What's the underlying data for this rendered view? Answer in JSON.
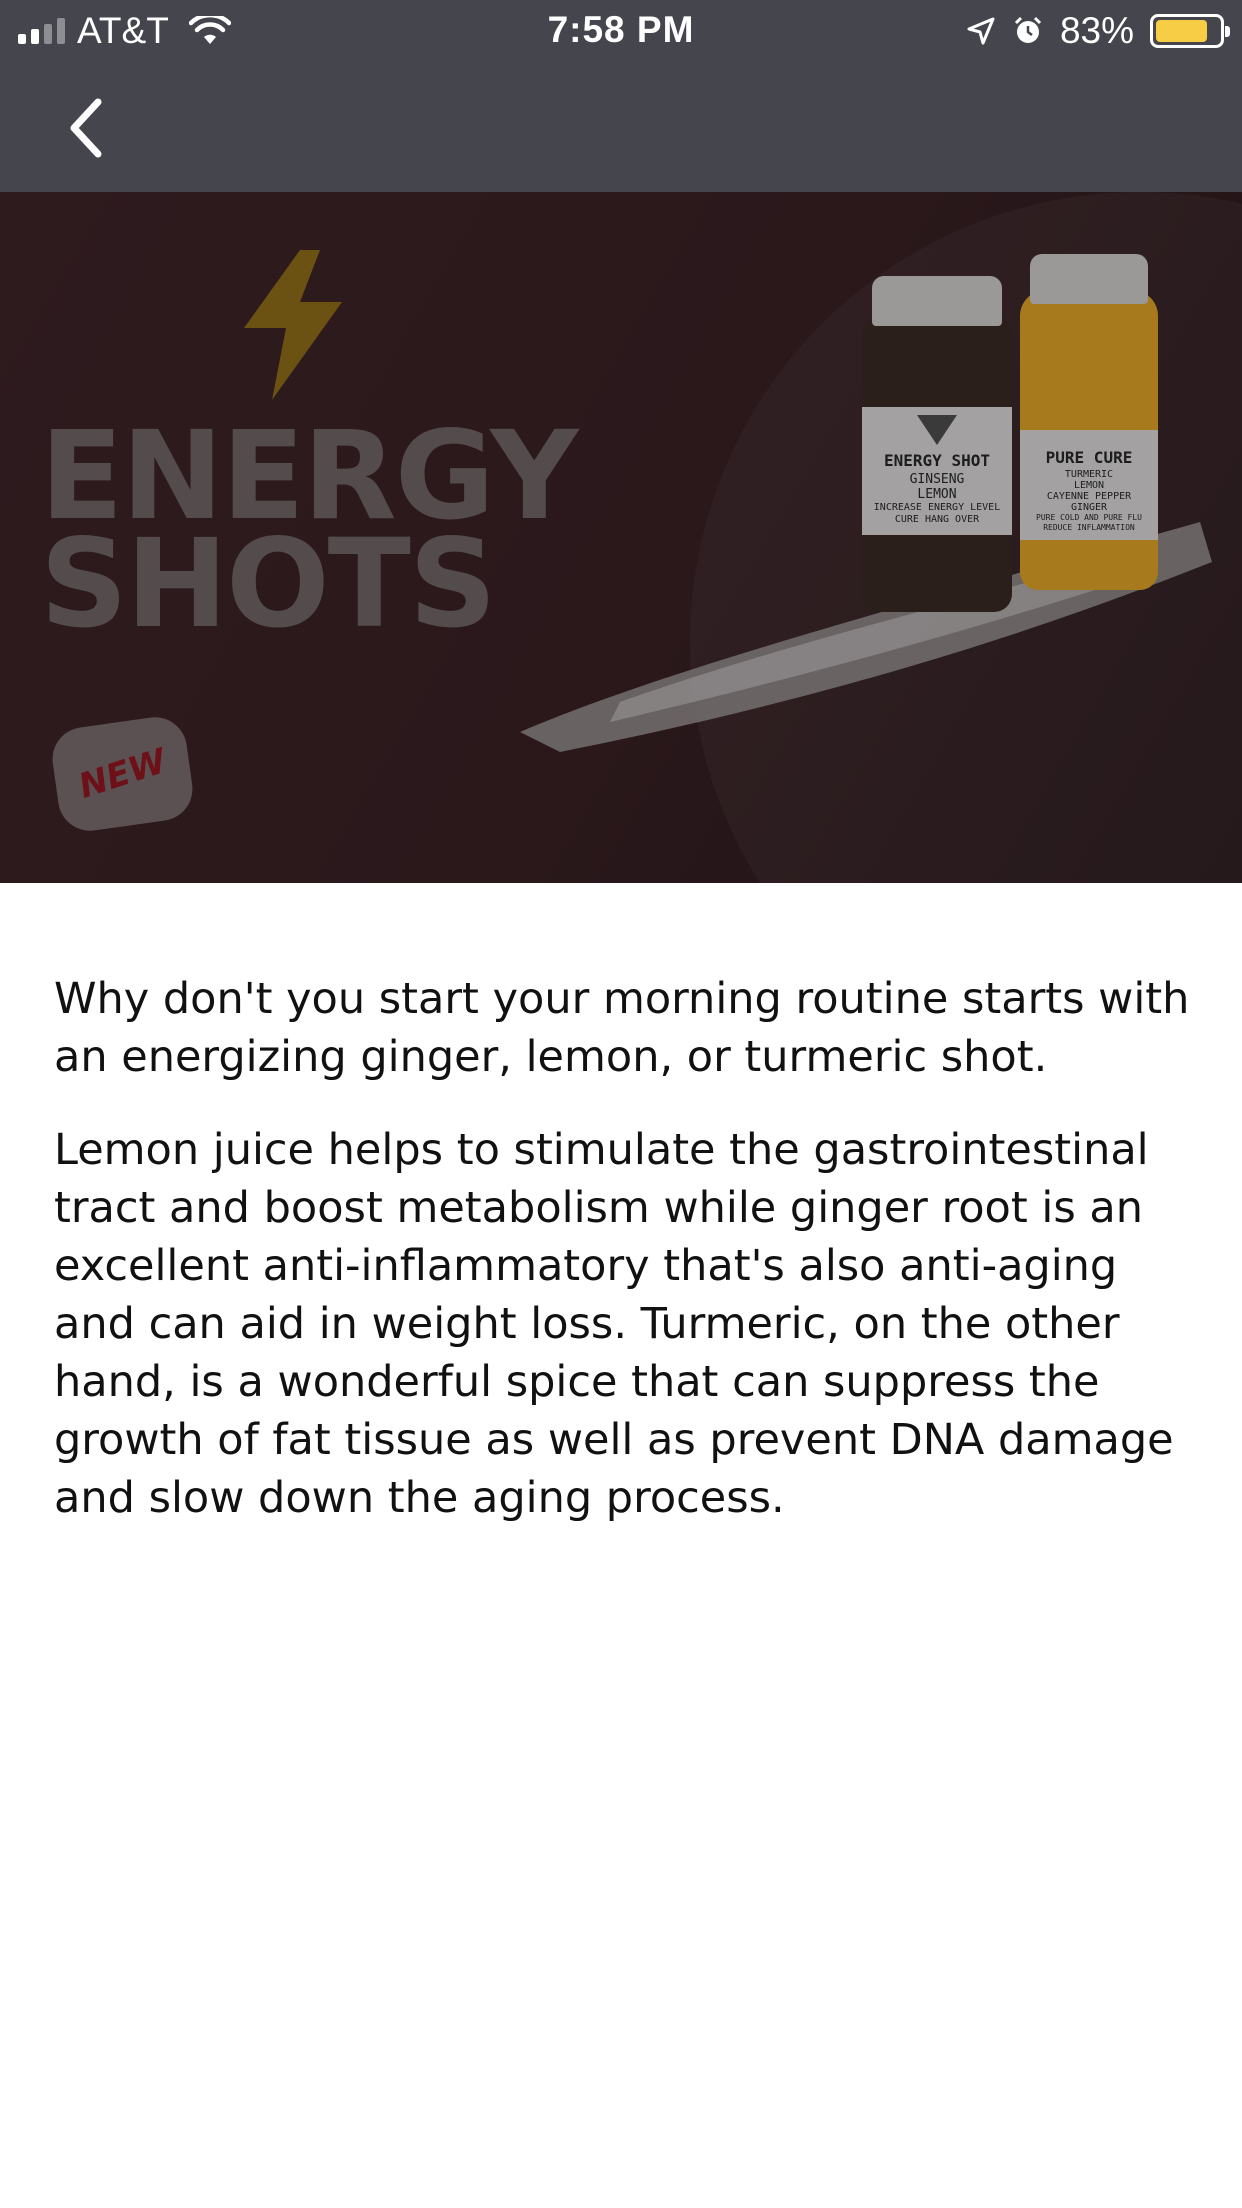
{
  "status_bar": {
    "carrier": "AT&T",
    "time": "7:58 PM",
    "battery": "83%",
    "battery_level": 0.83
  },
  "nav": {
    "back_icon": "chevron-left-icon"
  },
  "hero": {
    "headline": "ENERGY\nSHOTS",
    "badge": "NEW",
    "bottles": [
      {
        "name": "ENERGY SHOT",
        "lines": [
          "GINSENG",
          "LEMON",
          "INCREASE ENERGY LEVEL",
          "CURE HANG OVER"
        ]
      },
      {
        "name": "PURE CURE",
        "lines": [
          "TURMERIC",
          "LEMON",
          "CAYENNE PEPPER",
          "GINGER",
          "PURE COLD AND PURE FLU",
          "REDUCE INFLAMMATION"
        ]
      }
    ]
  },
  "article": {
    "paragraphs": [
      "Why don't you start your morning routine starts with an energizing ginger, lemon, or turmeric shot.",
      "Lemon juice helps to stimulate the gastrointestinal tract and boost metabolism while ginger root is an excellent anti-inflammatory that's also anti-aging and can aid in weight loss. Turmeric, on the other hand, is a wonderful spice that can suppress the growth of fat tissue as well as prevent DNA damage and slow down the aging process."
    ]
  },
  "colors": {
    "header_bg": "#45454e",
    "hero_bg": "#2e1b1e",
    "battery_fill": "#f7cd45",
    "text": "#111111"
  }
}
